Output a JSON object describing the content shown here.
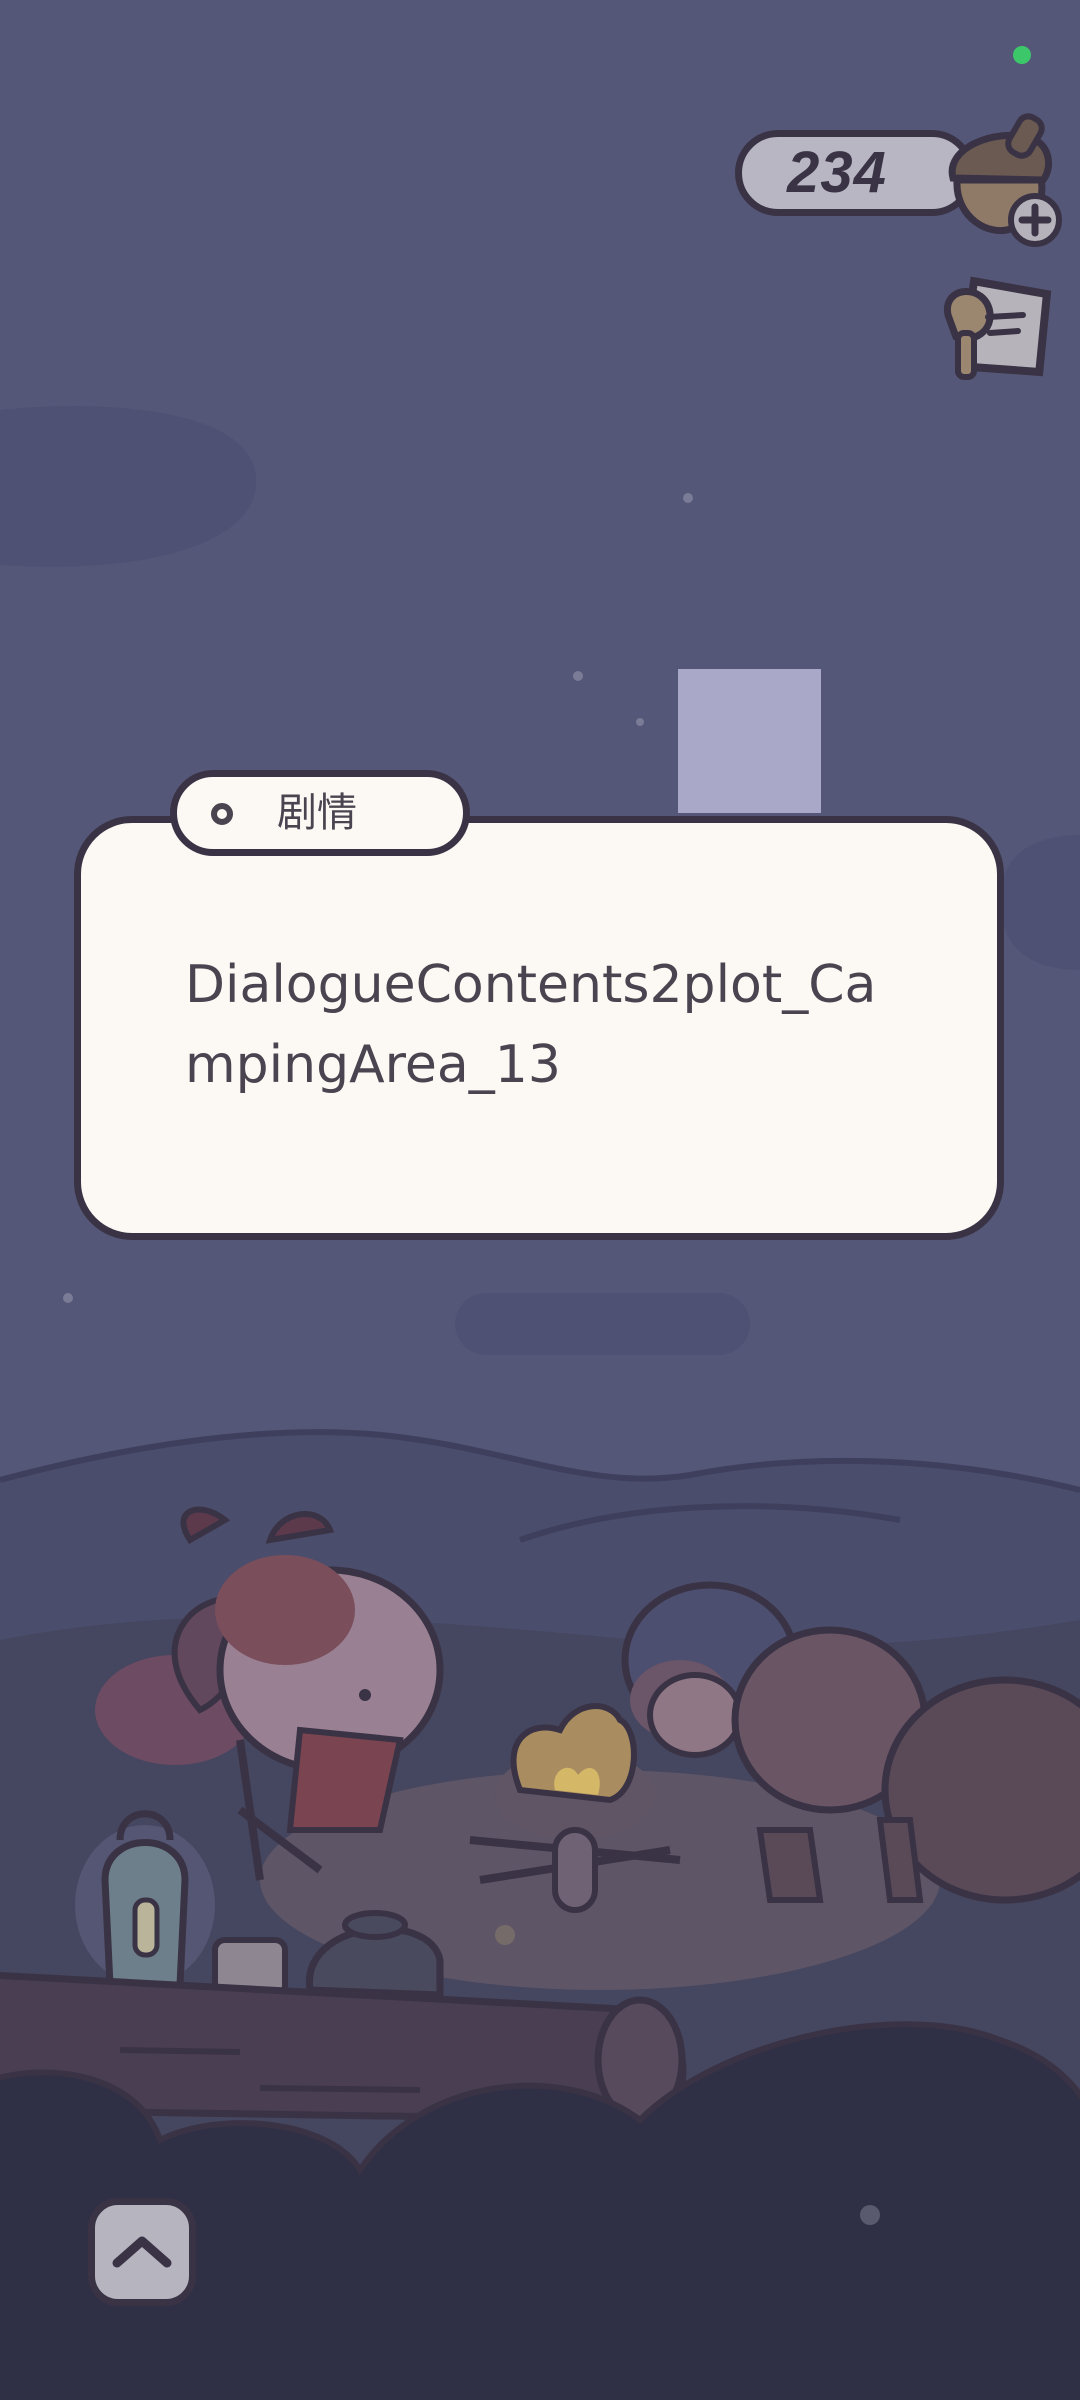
{
  "hud": {
    "acorn_count": "234",
    "currency_icon": "acorn-plus-icon",
    "notice_icon": "bulletin-sign-icon"
  },
  "dialogue": {
    "tab_label": "剧情",
    "text": "DialogueContents2plot_CampingArea_13"
  },
  "controls": {
    "expand_icon": "chevron-up-icon"
  },
  "colors": {
    "sky": "#555778",
    "dialog_bg": "#fcf8f3",
    "outline": "#3a3345",
    "status": "#3cc86a"
  }
}
